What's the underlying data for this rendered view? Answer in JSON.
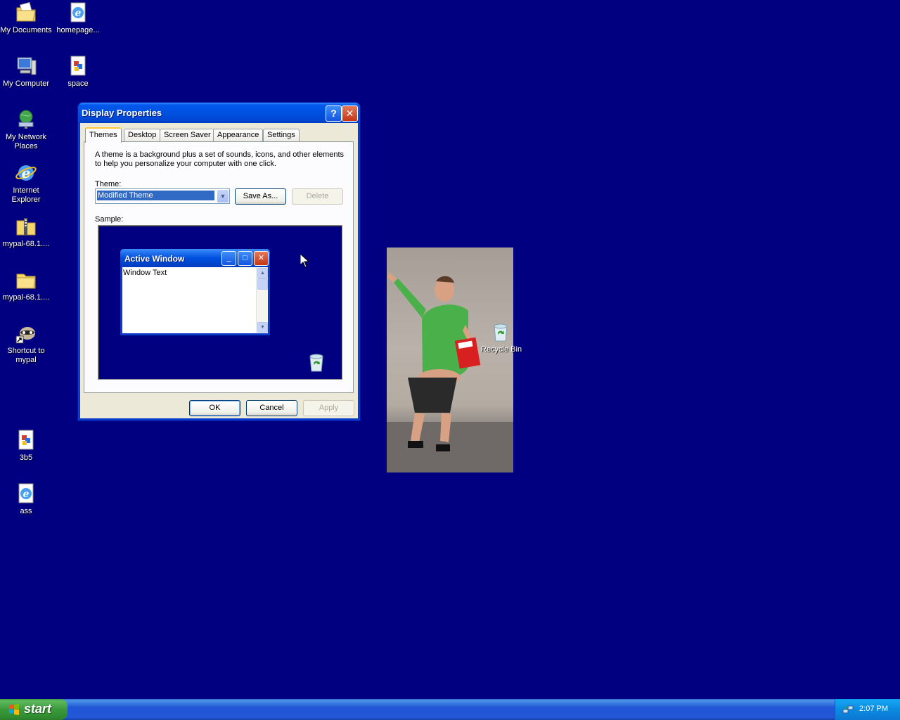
{
  "desktop": {
    "icons": [
      {
        "label": "My Documents",
        "icon": "folder-documents-icon"
      },
      {
        "label": "homepage...",
        "icon": "ie-shortcut-icon"
      },
      {
        "label": "My Computer",
        "icon": "computer-icon"
      },
      {
        "label": "space",
        "icon": "image-file-icon"
      },
      {
        "label": "My Network Places",
        "icon": "network-icon"
      },
      {
        "label": "Internet Explorer",
        "icon": "ie-icon"
      },
      {
        "label": "mypal-68.1....",
        "icon": "zip-folder-icon"
      },
      {
        "label": "mypal-68.1....",
        "icon": "folder-icon"
      },
      {
        "label": "Shortcut to mypal",
        "icon": "raccoon-shortcut-icon"
      },
      {
        "label": "3b5",
        "icon": "image-file-icon"
      },
      {
        "label": "ass",
        "icon": "ie-shortcut-icon"
      }
    ],
    "recycle_bin_label": "Recycle Bin"
  },
  "window": {
    "title": "Display Properties",
    "help_button": "?",
    "close_button": "✕",
    "tabs": [
      "Themes",
      "Desktop",
      "Screen Saver",
      "Appearance",
      "Settings"
    ],
    "active_tab": "Themes",
    "description": "A theme is a background plus a set of sounds, icons, and other elements to help you personalize your computer with one click.",
    "theme_label": "Theme:",
    "theme_value": "Modified Theme",
    "save_as_label": "Save As...",
    "delete_label": "Delete",
    "sample_label": "Sample:",
    "sample": {
      "window_title": "Active Window",
      "window_text": "Window Text"
    },
    "ok_label": "OK",
    "cancel_label": "Cancel",
    "apply_label": "Apply"
  },
  "taskbar": {
    "start_label": "start",
    "clock": "2:07 PM"
  },
  "colors": {
    "desktop_background": "#000080",
    "title_bar": "#0050e0",
    "start_button": "#3a9a3a",
    "taskbar": "#2157d7"
  }
}
